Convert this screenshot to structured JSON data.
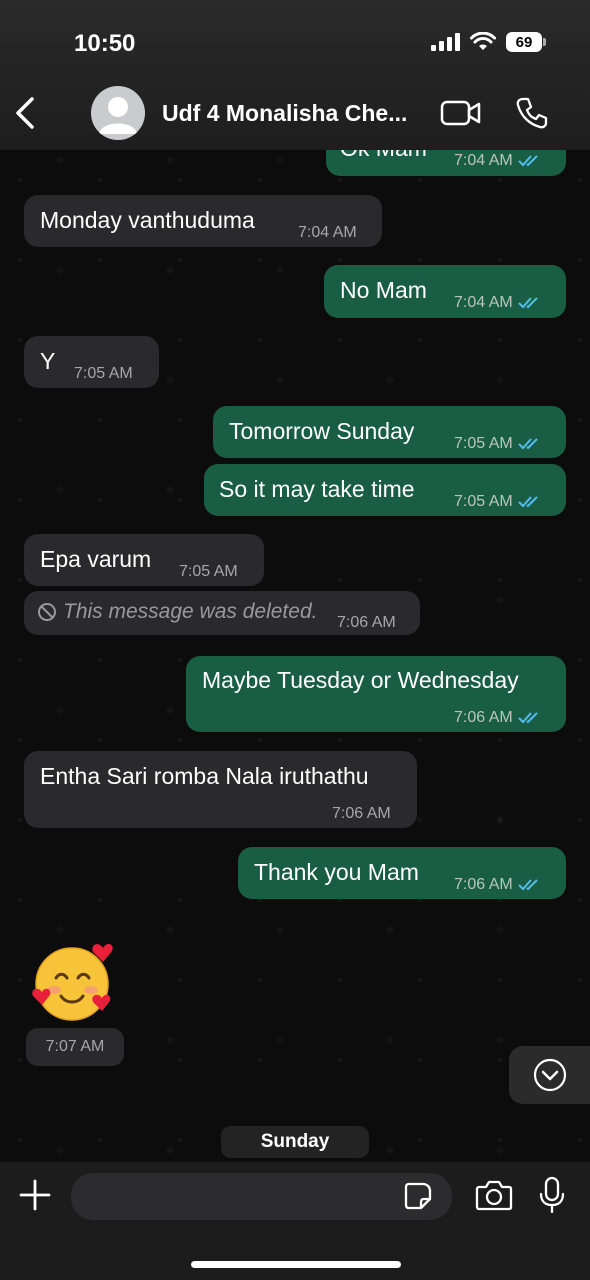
{
  "status_bar": {
    "time": "10:50",
    "battery": "69"
  },
  "header": {
    "contact_name": "Udf 4 Monalisha Che..."
  },
  "messages": [
    {
      "dir": "out",
      "text": "Ok Mam",
      "time": "7:04 AM"
    },
    {
      "dir": "in",
      "text": "Monday vanthuduma",
      "time": "7:04 AM"
    },
    {
      "dir": "out",
      "text": "No Mam",
      "time": "7:04 AM"
    },
    {
      "dir": "in",
      "text": "Y",
      "time": "7:05 AM"
    },
    {
      "dir": "out",
      "text": "Tomorrow Sunday",
      "time": "7:05 AM"
    },
    {
      "dir": "out",
      "text": "So it may take time",
      "time": "7:05 AM"
    },
    {
      "dir": "in",
      "text": "Epa varum",
      "time": "7:05 AM"
    },
    {
      "dir": "in",
      "text": "This message was deleted.",
      "time": "7:06 AM",
      "deleted": true
    },
    {
      "dir": "out",
      "text": "Maybe Tuesday or Wednesday",
      "time": "7:06 AM"
    },
    {
      "dir": "in",
      "text": "Entha Sari romba Nala iruthathu",
      "time": "7:06 AM"
    },
    {
      "dir": "out",
      "text": "Thank you Mam",
      "time": "7:06 AM"
    },
    {
      "dir": "in",
      "text": "",
      "emoji": "smiling-face-with-hearts",
      "time": "7:07 AM"
    }
  ],
  "date_label": "Sunday",
  "colors": {
    "outgoing": "#1a5d45",
    "incoming": "#2a2a2c",
    "read_ticks": "#53bdeb"
  }
}
